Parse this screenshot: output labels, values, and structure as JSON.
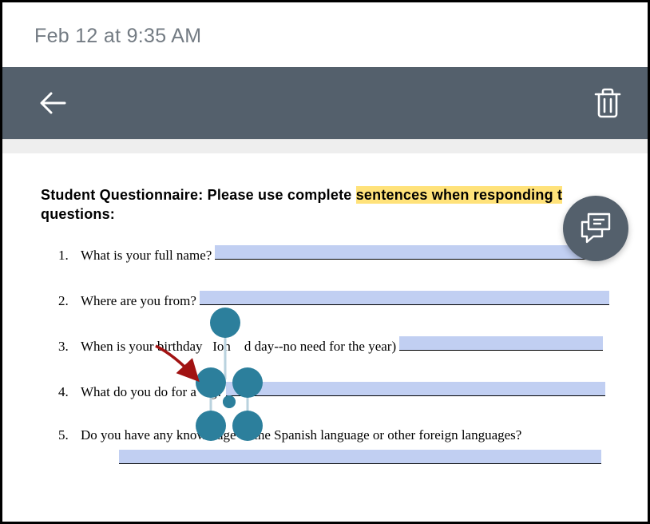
{
  "timestamp": "Feb 12 at 9:35 AM",
  "doc": {
    "title_before_highlight": "Student Questionnaire: Please use complete ",
    "title_highlight": "sentences when responding t",
    "title_after_highlight": "        ",
    "title_line2": "questions:",
    "questions": [
      {
        "num": "1.",
        "text": "What is your full name?"
      },
      {
        "num": "2.",
        "text": "Where are you from?"
      },
      {
        "num": "3.",
        "text_a": "When is your birthday",
        "text_b": "Ion",
        "text_c": "d day--no need for the year)"
      },
      {
        "num": "4.",
        "text_a": "What do you do for a ",
        "text_b": "g?"
      },
      {
        "num": "5.",
        "text": "Do you have any knowledge of the Spanish language or other foreign languages?"
      }
    ]
  },
  "annotation": {
    "color": "#2c7f9c",
    "handle_radius": 19,
    "small_radius": 8
  }
}
